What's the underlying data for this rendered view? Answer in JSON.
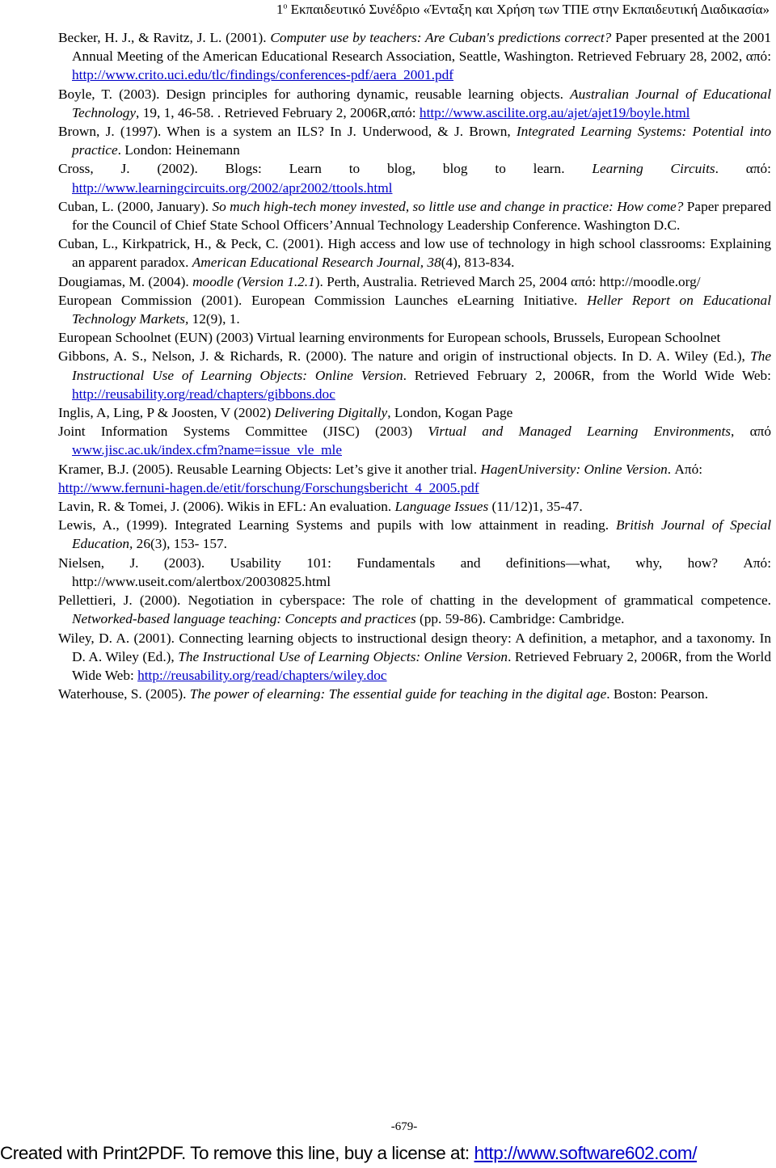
{
  "header": {
    "superscript_prefix": "1",
    "superscript": "ο",
    "title": " Εκπαιδευτικό Συνέδριο «Ένταξη και Χρήση των ΤΠΕ στην Εκπαιδευτική Διαδικασία»"
  },
  "references": [
    {
      "segments": [
        {
          "t": "Becker, H. J., & Ravitz, J. L. (2001). ",
          "s": "n"
        },
        {
          "t": "Computer use by teachers: Are Cuban's predictions correct?",
          "s": "i"
        },
        {
          "t": " Paper presented at the 2001 Annual Meeting of the American Educational Research Association, Seattle, Washington. Retrieved February 28, 2002, από: ",
          "s": "n"
        },
        {
          "t": "http://www.crito.uci.edu/tlc/findings/conferences-pdf/aera_2001.pdf",
          "s": "l"
        }
      ]
    },
    {
      "segments": [
        {
          "t": "Boyle, T. (2003). Design principles for authoring dynamic, reusable learning objects. ",
          "s": "n"
        },
        {
          "t": "Australian Journal of Educational Technology",
          "s": "i"
        },
        {
          "t": ", 19, 1, 46-58. . Retrieved February 2, 2006R,από: ",
          "s": "n"
        },
        {
          "t": "http://www.ascilite.org.au/ajet/ajet19/boyle.html",
          "s": "l"
        }
      ]
    },
    {
      "segments": [
        {
          "t": "Brown, J. (1997). When is a system an ILS? In J. Underwood, & J. Brown, ",
          "s": "n"
        },
        {
          "t": "Integrated Learning Systems: Potential into practice",
          "s": "i"
        },
        {
          "t": ". London: Heinemann",
          "s": "n"
        }
      ]
    },
    {
      "segments": [
        {
          "t": "Cross, J. (2002). Blogs: Learn to blog, blog to learn. ",
          "s": "n"
        },
        {
          "t": "Learning Circuits",
          "s": "i"
        },
        {
          "t": ". από: ",
          "s": "n"
        },
        {
          "t": "http://www.learningcircuits.org/2002/apr2002/ttools.html",
          "s": "l"
        }
      ]
    },
    {
      "segments": [
        {
          "t": "Cuban, L. (2000, January). ",
          "s": "n"
        },
        {
          "t": "So much high-tech money invested, so little use and change in practice: How come?",
          "s": "i"
        },
        {
          "t": " Paper prepared for the Council of Chief State School Officers’Annual Technology Leadership Conference. Washington D.C.",
          "s": "n"
        }
      ]
    },
    {
      "segments": [
        {
          "t": "Cuban, L., Kirkpatrick, H., & Peck, C. (2001). High access and low use of technology in high school classrooms: Explaining an apparent paradox. ",
          "s": "n"
        },
        {
          "t": "American Educational Research Journal, 38",
          "s": "i"
        },
        {
          "t": "(4), 813-834.",
          "s": "n"
        }
      ]
    },
    {
      "segments": [
        {
          "t": "Dougiamas, M. (2004). ",
          "s": "n"
        },
        {
          "t": "moodle (Version 1.2.1",
          "s": "i"
        },
        {
          "t": "). Perth, Australia. Retrieved March 25, 2004 από: http://moodle.org/",
          "s": "n"
        }
      ]
    },
    {
      "segments": [
        {
          "t": "European Commission (2001). European Commission Launches eLearning Initiative. ",
          "s": "n"
        },
        {
          "t": "Heller Report on Educational Technology Markets,",
          "s": "i"
        },
        {
          "t": " 12(9), 1.",
          "s": "n"
        }
      ]
    },
    {
      "segments": [
        {
          "t": "European Schoolnet (EUN) (2003) Virtual learning environments for European schools, Brussels, European Schoolnet",
          "s": "n"
        }
      ]
    },
    {
      "segments": [
        {
          "t": "Gibbons, A. S., Nelson, J. & Richards, R. (2000). The nature and origin of instructional objects. In D. A. Wiley (Ed.), ",
          "s": "n"
        },
        {
          "t": "The Instructional Use of Learning Objects: Online Version",
          "s": "i"
        },
        {
          "t": ". Retrieved February 2, 2006R, from the World Wide Web: ",
          "s": "n"
        },
        {
          "t": "http://reusability.org/read/chapters/gibbons.doc",
          "s": "l"
        }
      ]
    },
    {
      "segments": [
        {
          "t": "Inglis, A, Ling, P & Joosten, V (2002) ",
          "s": "n"
        },
        {
          "t": "Delivering Digitally",
          "s": "i"
        },
        {
          "t": ", London, Kogan Page",
          "s": "n"
        }
      ]
    },
    {
      "segments": [
        {
          "t": "Joint Information Systems Committee (JISC) (2003) ",
          "s": "n"
        },
        {
          "t": "Virtual and Managed Learning Environments",
          "s": "i"
        },
        {
          "t": ",  από ",
          "s": "n"
        },
        {
          "t": "www.jisc.ac.uk/index.cfm?name=issue_vle_mle",
          "s": "l"
        }
      ]
    },
    {
      "segments": [
        {
          "t": "Kramer, B.J. (2005). Reusable Learning Objects: Let’s give it another trial. ",
          "s": "n"
        },
        {
          "t": "HagenUniversity: Online Version",
          "s": "i"
        },
        {
          "t": ". Από:",
          "s": "n"
        },
        {
          "t": "http://www.fernuni-hagen.de/etit/forschung/Forschungsbericht_4_2005.pdf",
          "s": "lb"
        }
      ]
    },
    {
      "segments": [
        {
          "t": "Lavin, R. & Tomei, J. (2006). Wikis in EFL: An evaluation. ",
          "s": "n"
        },
        {
          "t": "Language Issues",
          "s": "i"
        },
        {
          "t": " (11/12)1, 35-47.",
          "s": "n"
        }
      ]
    },
    {
      "segments": [
        {
          "t": "Lewis, A., (1999). Integrated Learning Systems and pupils with low attainment in reading. ",
          "s": "n"
        },
        {
          "t": "British Journal of Special Education,",
          "s": "i"
        },
        {
          "t": " 26(3), 153- 157.",
          "s": "n"
        }
      ]
    },
    {
      "segments": [
        {
          "t": "Nielsen, J. (2003). Usability 101: Fundamentals and definitions—what, why, how? Από: http://www.useit.com/alertbox/20030825.html",
          "s": "n"
        }
      ]
    },
    {
      "segments": [
        {
          "t": "Pellettieri, J. (2000). Negotiation in cyberspace: The role of chatting in the development of grammatical competence. ",
          "s": "n"
        },
        {
          "t": "Networked-based language teaching: Concepts and practices",
          "s": "i"
        },
        {
          "t": " (pp. 59-86). Cambridge: Cambridge.",
          "s": "n"
        }
      ]
    },
    {
      "segments": [
        {
          "t": "Wiley, D. A. (2001). Connecting learning objects to instructional design theory: A definition, a metaphor, and a taxonomy. In D. A. Wiley (Ed.), ",
          "s": "n"
        },
        {
          "t": "The Instructional Use of Learning Objects: Online Version",
          "s": "i"
        },
        {
          "t": ". Retrieved February 2, 2006R, from the World Wide Web: ",
          "s": "n"
        },
        {
          "t": "http://reusability.org/read/chapters/wiley.doc",
          "s": "l"
        }
      ]
    },
    {
      "segments": [
        {
          "t": "Waterhouse, S. (2005). ",
          "s": "n"
        },
        {
          "t": "The power of elearning: The essential guide for teaching in the digital age",
          "s": "i"
        },
        {
          "t": ". Boston: Pearson.",
          "s": "n"
        }
      ]
    }
  ],
  "page_number": "-679-",
  "footer": {
    "text": "Created with Print2PDF. To remove this line, buy a license at: ",
    "link": "http://www.software602.com/",
    "link_color": "#0000c8"
  }
}
